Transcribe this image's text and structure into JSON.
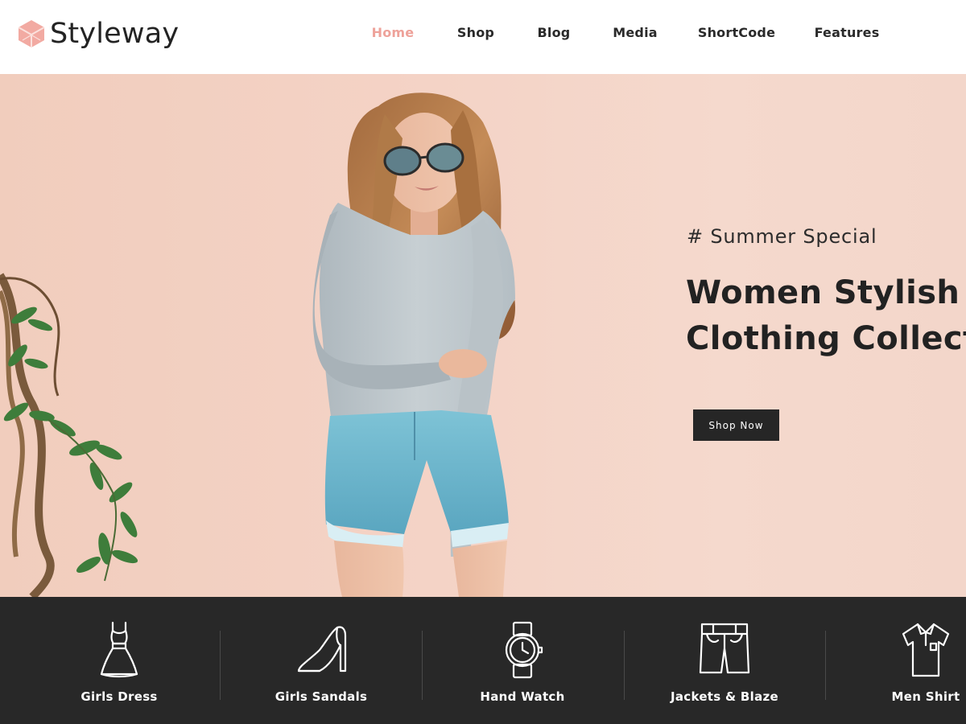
{
  "brand": {
    "name": "Styleway",
    "accent_color": "#eea29a",
    "logo_icon": "hexagon-cube-icon"
  },
  "nav": {
    "items": [
      {
        "label": "Home",
        "active": true
      },
      {
        "label": "Shop",
        "active": false
      },
      {
        "label": "Blog",
        "active": false
      },
      {
        "label": "Media",
        "active": false
      },
      {
        "label": "ShortCode",
        "active": false
      },
      {
        "label": "Features",
        "active": false
      }
    ]
  },
  "hero": {
    "tag": "# Summer Special",
    "title_line1": "Women Stylish",
    "title_line2": "Clothing Collect",
    "button_label": "Shop Now",
    "background_color": "#f3d3c6"
  },
  "categories": {
    "bar_color": "#282828",
    "items": [
      {
        "label": "Girls Dress",
        "icon": "dress-icon"
      },
      {
        "label": "Girls Sandals",
        "icon": "high-heel-icon"
      },
      {
        "label": "Hand Watch",
        "icon": "wristwatch-icon"
      },
      {
        "label": "Jackets & Blaze",
        "icon": "shorts-icon"
      },
      {
        "label": "Men Shirt",
        "icon": "polo-shirt-icon"
      }
    ]
  }
}
